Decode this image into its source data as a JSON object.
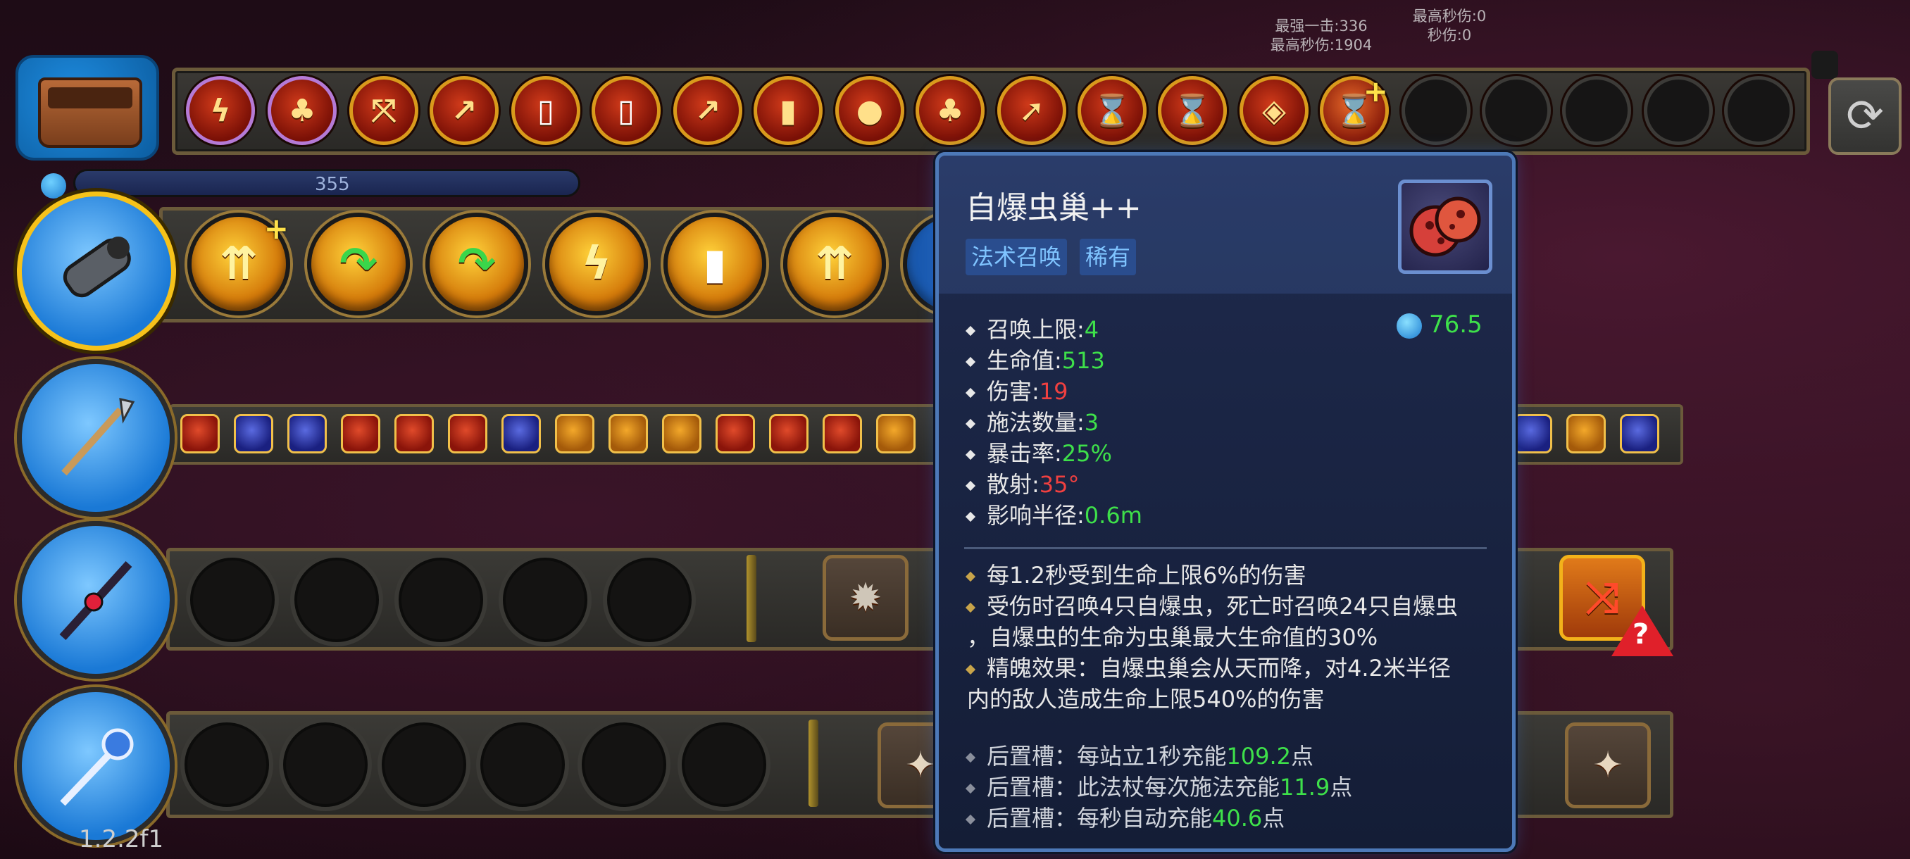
{
  "top_stats": {
    "left_line1": "最强一击:336",
    "left_line2": "最高秒伤:1904",
    "right_line1": "最高秒伤:0",
    "right_line2": "秒伤:0"
  },
  "mana_bar": {
    "value": "355"
  },
  "version": "1.2.2f1",
  "tooltip": {
    "title": "自爆虫巢++",
    "tags": [
      "法术召唤",
      "稀有"
    ],
    "mana_cost": "76.5",
    "stats": [
      {
        "label": "召唤上限:",
        "value": "4",
        "color": "#3ee04a"
      },
      {
        "label": "生命值:",
        "value": "513",
        "color": "#3ee04a"
      },
      {
        "label": "伤害:",
        "value": "19",
        "color": "#f04040"
      },
      {
        "label": "施法数量:",
        "value": "3",
        "color": "#3ee04a"
      },
      {
        "label": "暴击率:",
        "value": "25%",
        "color": "#3ee04a"
      },
      {
        "label": "散射:",
        "value": "35°",
        "color": "#f04040"
      },
      {
        "label": "影响半径:",
        "value": "0.6m",
        "color": "#3ee04a"
      }
    ],
    "desc1": "每1.2秒受到生命上限6%的伤害",
    "desc2_line1": "受伤时召唤4只自爆虫，死亡时召唤24只自爆虫",
    "desc2_line2": "，自爆虫的生命为虫巢最大生命值的30%",
    "desc3_line1": "精魄效果：自爆虫巢会从天而降，对4.2米半径",
    "desc3_line2": "内的敌人造成生命上限540%的伤害",
    "post": [
      {
        "prefix": "后置槽：每站立1秒充能",
        "value": "109.2",
        "suffix": "点"
      },
      {
        "prefix": "后置槽：此法杖每次施法充能",
        "value": "11.9",
        "suffix": "点"
      },
      {
        "prefix": "后置槽：每秒自动充能",
        "value": "40.6",
        "suffix": "点"
      }
    ]
  },
  "icons": {
    "chest": "inventory-chest-icon",
    "refresh": "refresh-icon",
    "wand1": "cannon-wand-icon",
    "wand2": "spear-wand-icon",
    "wand3": "dark-staff-icon",
    "wand4": "crystal-staff-icon"
  },
  "colors": {
    "accent_gold": "#d99a1c",
    "tooltip_border": "#4d79b8",
    "positive": "#3ee04a",
    "negative": "#f04040"
  }
}
